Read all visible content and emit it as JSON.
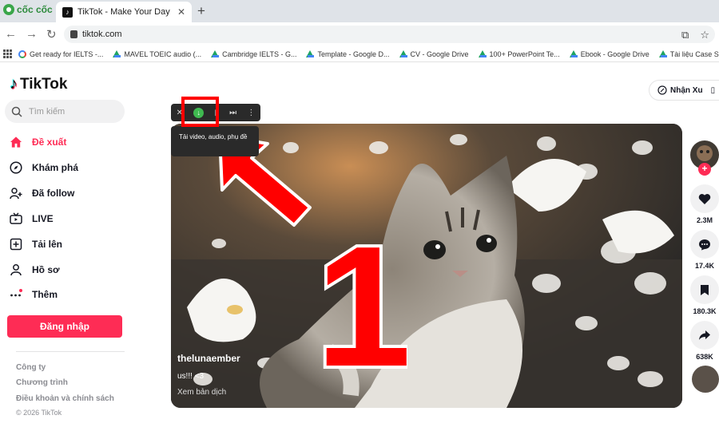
{
  "browser": {
    "brand": "cốc cốc",
    "tab_title": "TikTok - Make Your Day",
    "url": "tiktok.com",
    "bookmarks": [
      {
        "label": "Get ready for IELTS -...",
        "icon": "google-icon"
      },
      {
        "label": "MAVEL TOEIC audio (...",
        "icon": "google-drive-icon"
      },
      {
        "label": "Cambridge IELTS - G...",
        "icon": "google-drive-icon"
      },
      {
        "label": "Template - Google D...",
        "icon": "google-drive-icon"
      },
      {
        "label": "CV - Google Drive",
        "icon": "google-drive-icon"
      },
      {
        "label": "100+ PowerPoint Te...",
        "icon": "google-drive-icon"
      },
      {
        "label": "Ebook - Google Drive",
        "icon": "google-drive-icon"
      },
      {
        "label": "Tài liệu Case Study -...",
        "icon": "google-drive-icon"
      }
    ]
  },
  "tiktok": {
    "logo": "TikTok",
    "search_placeholder": "Tìm kiếm",
    "nav": [
      {
        "label": "Đề xuất",
        "icon": "home-icon",
        "active": true
      },
      {
        "label": "Khám phá",
        "icon": "compass-icon"
      },
      {
        "label": "Đã follow",
        "icon": "user-plus-icon"
      },
      {
        "label": "LIVE",
        "icon": "tv-icon"
      },
      {
        "label": "Tải lên",
        "icon": "upload-icon"
      },
      {
        "label": "Hồ sơ",
        "icon": "profile-icon"
      },
      {
        "label": "Thêm",
        "icon": "more-icon"
      }
    ],
    "login_label": "Đăng nhập",
    "footer": [
      "Công ty",
      "Chương trình",
      "Điều khoản và chính sách"
    ],
    "copyright": "© 2026 TikTok",
    "coins_label": "Nhận Xu",
    "accent": "#fe2c55"
  },
  "video": {
    "username": "thelunaember",
    "caption": "us!!! <3",
    "translate": "Xem bản dịch",
    "tooltip": "Tải video, audio, phụ đề",
    "annotation_number": "1",
    "stats": {
      "likes": "2.3M",
      "comments": "17.4K",
      "saves": "180.3K",
      "shares": "638K"
    }
  }
}
